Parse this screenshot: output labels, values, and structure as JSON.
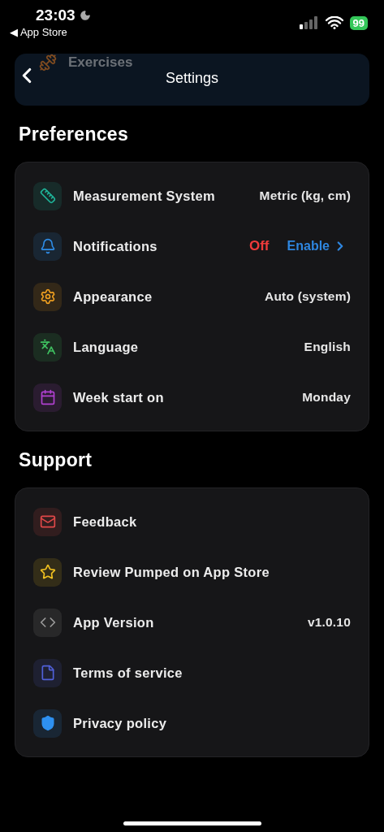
{
  "status_bar": {
    "time": "23:03",
    "back_link": "◀ App Store",
    "battery": "99"
  },
  "header": {
    "title": "Settings",
    "behind_row": {
      "label": "Exercises"
    }
  },
  "sections": [
    {
      "title": "Preferences",
      "items": [
        {
          "label": "Measurement System",
          "kind": "ruler",
          "color": "#1fb59a",
          "value": "Metric (kg, cm)"
        },
        {
          "label": "Notifications",
          "kind": "bell",
          "color": "#2e8ce6",
          "status": "Off",
          "action": "Enable"
        },
        {
          "label": "Appearance",
          "kind": "gear",
          "color": "#f0a020",
          "value": "Auto (system)"
        },
        {
          "label": "Language",
          "kind": "language",
          "color": "#3fc060",
          "value": "English"
        },
        {
          "label": "Week start on",
          "kind": "calendar",
          "color": "#b040d0",
          "value": "Monday"
        }
      ]
    },
    {
      "title": "Support",
      "items": [
        {
          "label": "Feedback",
          "kind": "mail",
          "color": "#e04848"
        },
        {
          "label": "Review Pumped on App Store",
          "kind": "star",
          "color": "#f0c020"
        },
        {
          "label": "App Version",
          "kind": "code",
          "color": "#9a9a9a",
          "value": "v1.0.10"
        },
        {
          "label": "Terms of service",
          "kind": "file",
          "color": "#5060d8"
        },
        {
          "label": "Privacy policy",
          "kind": "shield",
          "color": "#2e90f0"
        }
      ]
    }
  ]
}
